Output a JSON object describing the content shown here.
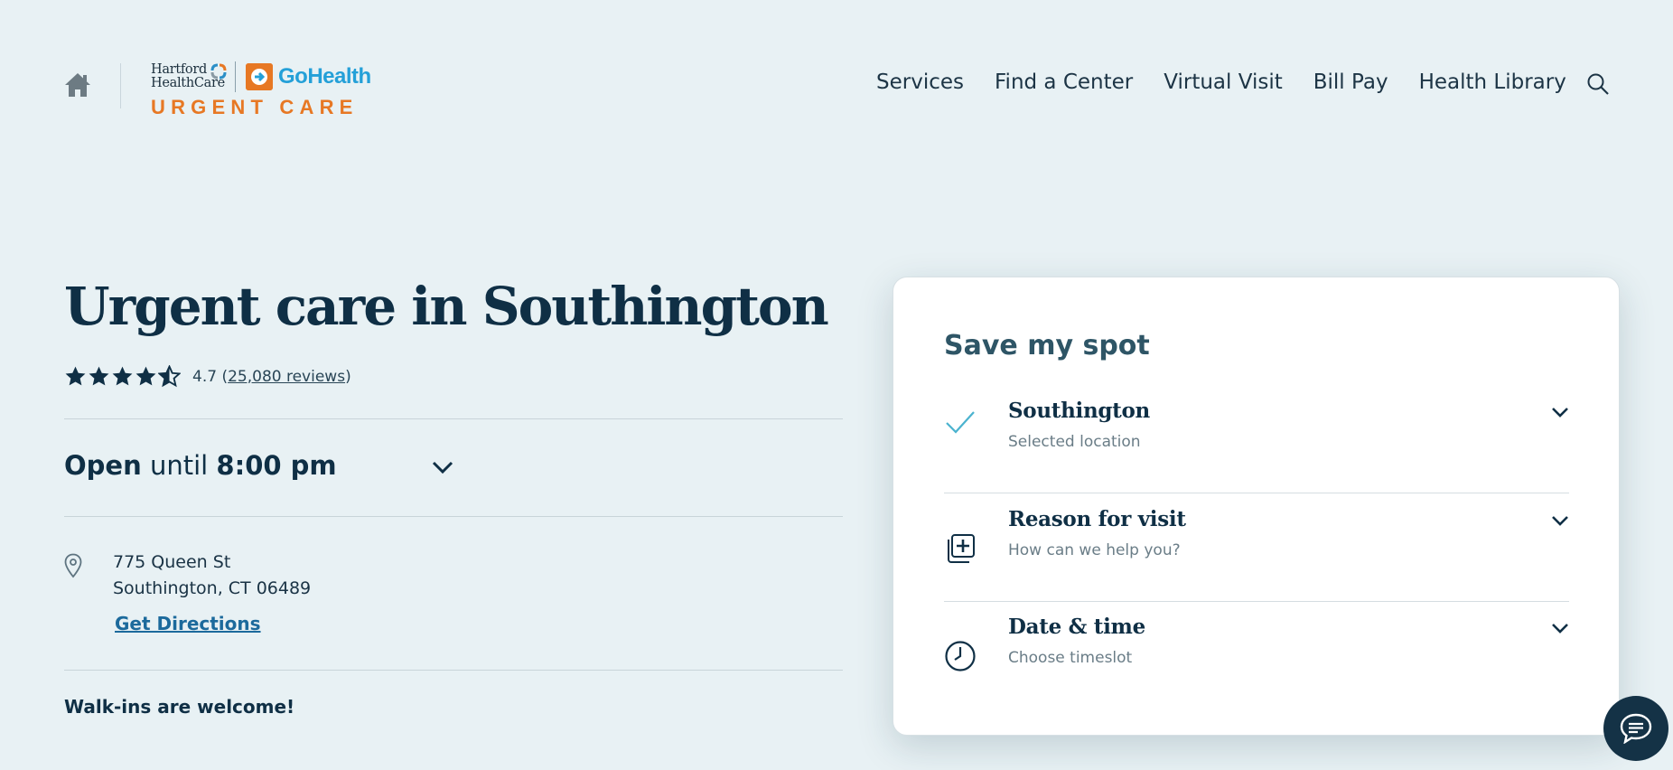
{
  "header": {
    "logo": {
      "brand_line1": "Hartford",
      "brand_line2": "HealthCare",
      "partner": "GoHealth",
      "product": "URGENT CARE"
    },
    "nav": [
      {
        "label": "Services"
      },
      {
        "label": "Find a Center"
      },
      {
        "label": "Virtual Visit"
      },
      {
        "label": "Bill Pay"
      },
      {
        "label": "Health Library"
      }
    ],
    "icons": {
      "home": "home-icon",
      "search": "search-icon"
    }
  },
  "location": {
    "title": "Urgent care in Southington",
    "rating": {
      "stars": 4.7,
      "value": "4.7",
      "reviews_label": "25,080 reviews"
    },
    "hours": {
      "status": "Open",
      "connector": "until",
      "time": "8:00 pm"
    },
    "address": {
      "line1": "775 Queen St",
      "line2": "Southington, CT 06489"
    },
    "directions_label": "Get Directions",
    "walkins": "Walk-ins are welcome!"
  },
  "booking": {
    "title": "Save my spot",
    "steps": [
      {
        "title": "Southington",
        "subtitle": "Selected location",
        "icon": "check-icon"
      },
      {
        "title": "Reason for visit",
        "subtitle": "How can we help you?",
        "icon": "medical-cross-icon"
      },
      {
        "title": "Date & time",
        "subtitle": "Choose timeslot",
        "icon": "clock-icon"
      }
    ]
  },
  "chat": {
    "icon": "chat-icon"
  },
  "colors": {
    "background": "#e8f1f4",
    "navy": "#0f2f45",
    "orange": "#e77824",
    "gohealth_blue": "#24a0d8",
    "link_blue": "#1c6a9c",
    "check_teal": "#4bb3cf"
  }
}
